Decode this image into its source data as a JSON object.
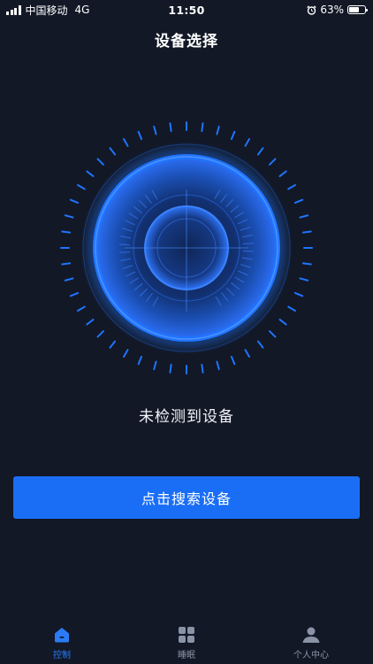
{
  "status_bar": {
    "carrier": "中国移动",
    "network": "4G",
    "time": "11:50",
    "alarm_icon": "alarm-clock-icon",
    "battery_percent": "63%",
    "battery_level": 0.63
  },
  "header": {
    "title": "设备选择"
  },
  "radar": {
    "icon": "radar-scan-icon",
    "accent_color": "#1f74ff",
    "glow_color": "#1b4fb3"
  },
  "main": {
    "status_text": "未检测到设备",
    "search_button_label": "点击搜索设备",
    "button_color": "#1a6ef6"
  },
  "tab_bar": {
    "items": [
      {
        "label": "控制",
        "icon": "home-icon",
        "active": true
      },
      {
        "label": "睡眠",
        "icon": "grid-icon",
        "active": false
      },
      {
        "label": "个人中心",
        "icon": "user-icon",
        "active": false
      }
    ],
    "active_color": "#2b7bf8",
    "inactive_color": "#8a93a6"
  }
}
